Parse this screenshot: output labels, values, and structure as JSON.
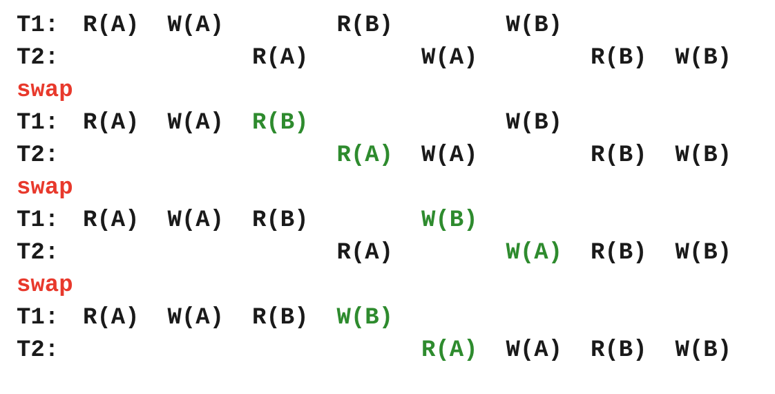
{
  "colors": {
    "text": "#1a1a1a",
    "swap": "#e8392c",
    "moved": "#2e8b2e"
  },
  "columns": 8,
  "lines": [
    {
      "kind": "txn",
      "label": "T1:",
      "ops": [
        {
          "text": "R(A)",
          "col": 0
        },
        {
          "text": "W(A)",
          "col": 1
        },
        {
          "text": "R(B)",
          "col": 3
        },
        {
          "text": "W(B)",
          "col": 5
        }
      ]
    },
    {
      "kind": "txn",
      "label": "T2:",
      "ops": [
        {
          "text": "R(A)",
          "col": 2
        },
        {
          "text": "W(A)",
          "col": 4
        },
        {
          "text": "R(B)",
          "col": 6
        },
        {
          "text": "W(B)",
          "col": 7
        }
      ]
    },
    {
      "kind": "swap",
      "label": "swap"
    },
    {
      "kind": "txn",
      "label": "T1:",
      "ops": [
        {
          "text": "R(A)",
          "col": 0
        },
        {
          "text": "W(A)",
          "col": 1
        },
        {
          "text": "R(B)",
          "col": 2,
          "moved": true
        },
        {
          "text": "W(B)",
          "col": 5
        }
      ]
    },
    {
      "kind": "txn",
      "label": "T2:",
      "ops": [
        {
          "text": "R(A)",
          "col": 3,
          "moved": true
        },
        {
          "text": "W(A)",
          "col": 4
        },
        {
          "text": "R(B)",
          "col": 6
        },
        {
          "text": "W(B)",
          "col": 7
        }
      ]
    },
    {
      "kind": "swap",
      "label": "swap"
    },
    {
      "kind": "txn",
      "label": "T1:",
      "ops": [
        {
          "text": "R(A)",
          "col": 0
        },
        {
          "text": "W(A)",
          "col": 1
        },
        {
          "text": "R(B)",
          "col": 2
        },
        {
          "text": "W(B)",
          "col": 4,
          "moved": true
        }
      ]
    },
    {
      "kind": "txn",
      "label": "T2:",
      "ops": [
        {
          "text": "R(A)",
          "col": 3
        },
        {
          "text": "W(A)",
          "col": 5,
          "moved": true
        },
        {
          "text": "R(B)",
          "col": 6
        },
        {
          "text": "W(B)",
          "col": 7
        }
      ]
    },
    {
      "kind": "swap",
      "label": "swap"
    },
    {
      "kind": "txn",
      "label": "T1:",
      "ops": [
        {
          "text": "R(A)",
          "col": 0
        },
        {
          "text": "W(A)",
          "col": 1
        },
        {
          "text": "R(B)",
          "col": 2
        },
        {
          "text": "W(B)",
          "col": 3,
          "moved": true
        }
      ]
    },
    {
      "kind": "txn",
      "label": "T2:",
      "ops": [
        {
          "text": "R(A)",
          "col": 4,
          "moved": true
        },
        {
          "text": "W(A)",
          "col": 5
        },
        {
          "text": "R(B)",
          "col": 6
        },
        {
          "text": "W(B)",
          "col": 7
        }
      ]
    }
  ]
}
